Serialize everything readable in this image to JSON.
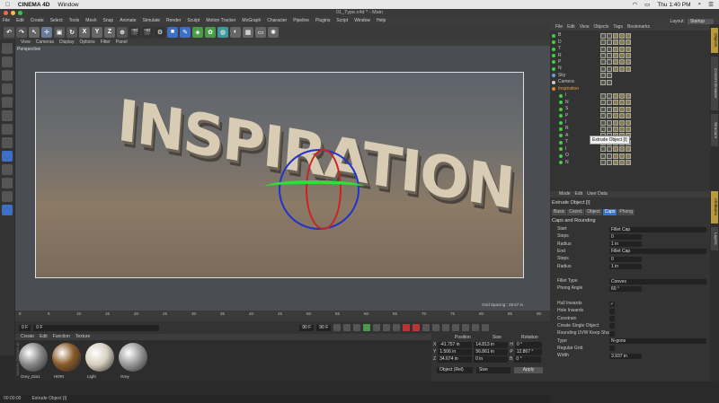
{
  "mac": {
    "apple": "",
    "app": "CINEMA 4D",
    "window": "Window",
    "time": "Thu 1:40 PM"
  },
  "window_title": "01_Type.c4d * - Main",
  "menu": [
    "File",
    "Edit",
    "Create",
    "Select",
    "Tools",
    "Mesh",
    "Snap",
    "Animate",
    "Simulate",
    "Render",
    "Sculpt",
    "Motion Tracker",
    "MoGraph",
    "Character",
    "Pipeline",
    "Plugins",
    "Script",
    "Window",
    "Help"
  ],
  "layout": {
    "label": "Layout:",
    "value": "Startup"
  },
  "toolbar": {
    "axis_x": "X",
    "axis_y": "Y",
    "axis_z": "Z"
  },
  "viewport": {
    "menu": [
      "View",
      "Cameras",
      "Display",
      "Options",
      "Filter",
      "Panel"
    ],
    "label": "Perspective",
    "scene_text": "INSPIRATION",
    "grid_spacing": "Grid Spacing : 28.57 in"
  },
  "timeline": {
    "ticks": [
      "0",
      "5",
      "10",
      "15",
      "20",
      "25",
      "30",
      "35",
      "40",
      "45",
      "50",
      "55",
      "60",
      "65",
      "70",
      "75",
      "80",
      "85",
      "90"
    ],
    "end_frame": "0 F",
    "start_field": "0 F",
    "min_field": "0 F",
    "max_field": "90 F",
    "max_field2": "90 F"
  },
  "material_manager": {
    "menu": [
      "Create",
      "Edit",
      "Function",
      "Texture"
    ],
    "materials": [
      {
        "name": "Grey_Dia1",
        "color": "#888"
      },
      {
        "name": "HDRI",
        "color": "#8a5a2a"
      },
      {
        "name": "Light",
        "color": "#d8d0c0"
      },
      {
        "name": "Grey",
        "color": "#9a9a9a"
      }
    ],
    "brand": "MAXON CINEMA 4D"
  },
  "coords": {
    "headers": [
      "Position",
      "Size",
      "Rotation"
    ],
    "rows": [
      {
        "axis": "X",
        "pos": "-41.757 in",
        "size": "14.813 in",
        "rl": "H",
        "rot": "0 °"
      },
      {
        "axis": "Y",
        "pos": "1.506 in",
        "size": "56.861 in",
        "rl": "P",
        "rot": "12.867 °"
      },
      {
        "axis": "Z",
        "pos": "34.674 in",
        "size": "0 in",
        "rl": "B",
        "rot": "0 °"
      }
    ],
    "mode1": "Object (Rel)",
    "mode2": "Size",
    "apply": "Apply"
  },
  "status": {
    "time": "00:00:00",
    "msg": "Extrude Object [I]"
  },
  "object_manager": {
    "menu": [
      "File",
      "Edit",
      "View",
      "Objects",
      "Tags",
      "Bookmarks"
    ],
    "items": [
      {
        "name": "B",
        "kind": "obj"
      },
      {
        "name": "D",
        "kind": "obj"
      },
      {
        "name": "T",
        "kind": "obj"
      },
      {
        "name": "R",
        "kind": "obj"
      },
      {
        "name": "P",
        "kind": "obj"
      },
      {
        "name": "N",
        "kind": "obj"
      },
      {
        "name": "Sky",
        "kind": "sky"
      },
      {
        "name": "Camera",
        "kind": "cam"
      },
      {
        "name": "Inspiration",
        "kind": "null"
      },
      {
        "name": "I",
        "kind": "obj"
      },
      {
        "name": "N",
        "kind": "obj"
      },
      {
        "name": "S",
        "kind": "obj"
      },
      {
        "name": "P",
        "kind": "obj"
      },
      {
        "name": "I",
        "kind": "obj"
      },
      {
        "name": "R",
        "kind": "obj"
      },
      {
        "name": "A",
        "kind": "obj"
      },
      {
        "name": "T",
        "kind": "obj"
      },
      {
        "name": "I",
        "kind": "obj"
      },
      {
        "name": "O",
        "kind": "obj"
      },
      {
        "name": "N",
        "kind": "obj"
      }
    ],
    "tooltip": "Extrude Object [I]"
  },
  "attributes": {
    "menu": [
      "Mode",
      "Edit",
      "User Data"
    ],
    "title": "Extrude Object [I]",
    "tabs": [
      "Basic",
      "Coord.",
      "Object",
      "Caps",
      "Phong"
    ],
    "active_tab": "Caps",
    "section": "Caps and Rounding",
    "rows": [
      {
        "label": "Start",
        "value": "Fillet Cap",
        "type": "drop"
      },
      {
        "label": "Steps",
        "value": "0",
        "type": "num"
      },
      {
        "label": "Radius",
        "value": "1 in",
        "type": "num"
      },
      {
        "label": "End",
        "value": "Fillet Cap",
        "type": "drop"
      },
      {
        "label": "Steps",
        "value": "0",
        "type": "num"
      },
      {
        "label": "Radius",
        "value": "1 in",
        "type": "num"
      },
      {
        "label": "",
        "value": "",
        "type": "gap"
      },
      {
        "label": "Fillet Type",
        "value": "Convex",
        "type": "drop"
      },
      {
        "label": "Phong Angle",
        "value": "60 °",
        "type": "num"
      },
      {
        "label": "",
        "value": "",
        "type": "gap"
      },
      {
        "label": "Hull Inwards",
        "value": "✓",
        "type": "check"
      },
      {
        "label": "Hole Inwards",
        "value": "",
        "type": "check"
      },
      {
        "label": "Constrain",
        "value": "",
        "type": "check"
      },
      {
        "label": "Create Single Object",
        "value": "",
        "type": "check"
      },
      {
        "label": "Rounding UVW Keep Shape",
        "value": "",
        "type": "check"
      },
      {
        "label": "Type",
        "value": "N-gons",
        "type": "drop"
      },
      {
        "label": "Regular Grid",
        "value": "",
        "type": "check"
      },
      {
        "label": "Width",
        "value": "3.937 in",
        "type": "num"
      }
    ]
  },
  "right_tabs": [
    "Objects",
    "Content Browser",
    "Structure",
    "Attributes",
    "Layers"
  ]
}
